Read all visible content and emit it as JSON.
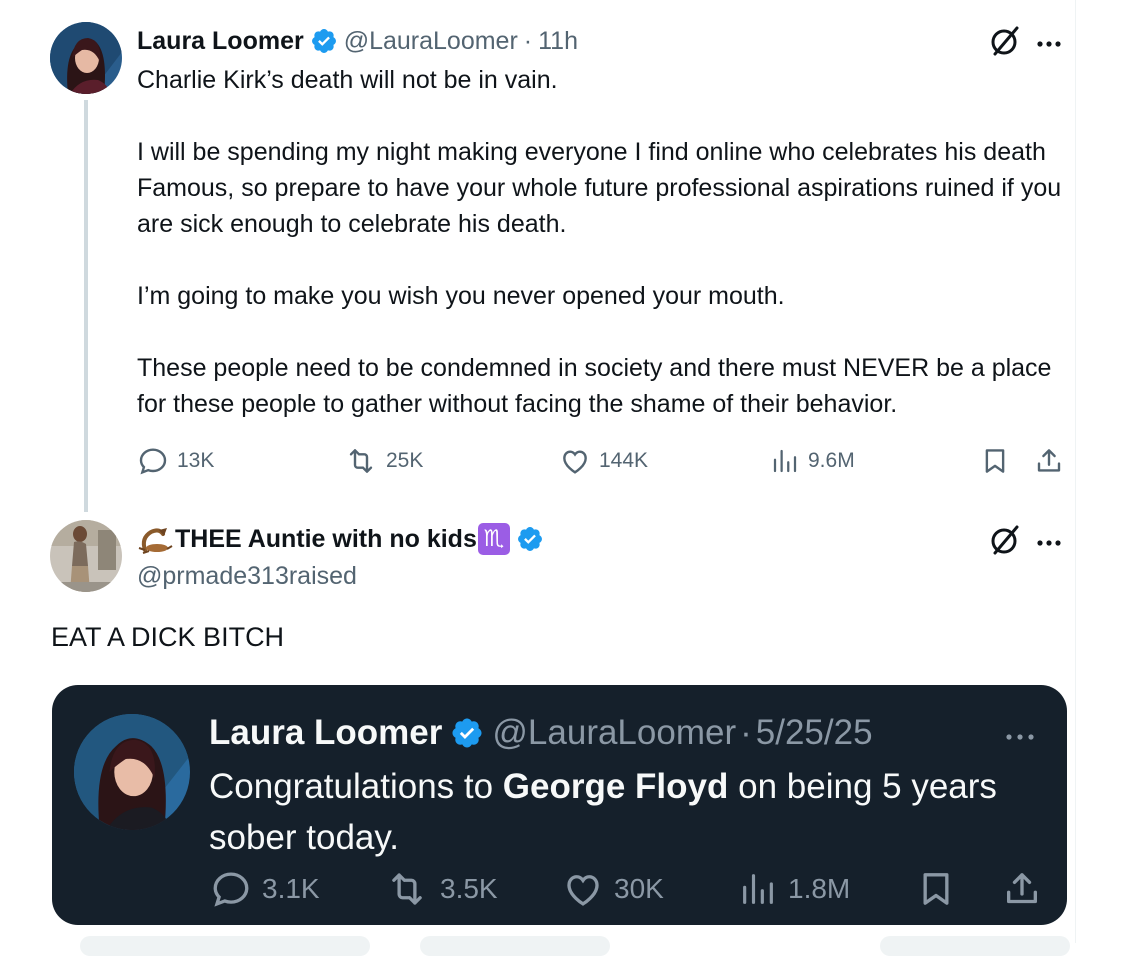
{
  "tweet": {
    "author_name": "Laura Loomer",
    "author_handle": "@LauraLoomer",
    "separator": "·",
    "time": "11h",
    "paragraphs": [
      "Charlie Kirk’s death will not be in vain.",
      "I will be spending my night making everyone I find online who celebrates his death Famous, so prepare to have your whole future professional aspirations ruined if you are sick enough to celebrate his death.",
      "I’m going to make you wish you never opened your mouth.",
      "These people need to be condemned in society and there must NEVER be a place for these people to gather without facing the shame of their behavior."
    ],
    "stats": {
      "replies": "13K",
      "reposts": "25K",
      "likes": "144K",
      "views": "9.6M"
    }
  },
  "reply": {
    "author_name": "THEE Auntie with no kids",
    "author_handle": "@prmade313raised",
    "zodiac_glyph": "♏",
    "text": "EAT A DICK BITCH",
    "quoted": {
      "author_name": "Laura Loomer",
      "author_handle": "@LauraLoomer",
      "separator": "·",
      "date": "5/25/25",
      "text_before": "Congratulations to ",
      "text_bold": "George Floyd",
      "text_after": " on being 5 years sober today.",
      "stats": {
        "replies": "3.1K",
        "reposts": "3.5K",
        "likes": "30K",
        "views": "1.8M"
      }
    }
  },
  "colors": {
    "verified": "#1d9bf0",
    "quote_background": "#15202b",
    "secondary_text": "#536471",
    "zodiac_badge": "#9b5de5"
  },
  "icons": [
    "verified-badge-icon",
    "grok-icon",
    "more-icon",
    "reply-icon",
    "repost-icon",
    "like-icon",
    "views-icon",
    "bookmark-icon",
    "share-icon",
    "scorpion-emoji-icon",
    "scorpio-zodiac-icon"
  ]
}
